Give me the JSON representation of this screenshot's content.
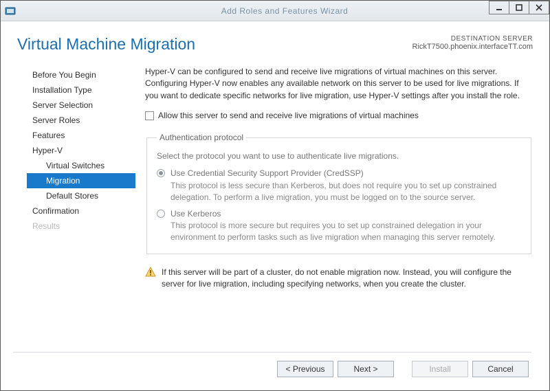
{
  "window": {
    "title": "Add Roles and Features Wizard",
    "minimize_tip": "Minimize",
    "maximize_tip": "Maximize",
    "close_tip": "Close"
  },
  "header": {
    "title": "Virtual Machine Migration",
    "dest_label": "DESTINATION SERVER",
    "dest_value": "RickT7500.phoenix.interfaceTT.com"
  },
  "nav": {
    "before": "Before You Begin",
    "install_type": "Installation Type",
    "server_selection": "Server Selection",
    "server_roles": "Server Roles",
    "features": "Features",
    "hyperv": "Hyper-V",
    "vswitches": "Virtual Switches",
    "migration": "Migration",
    "default_stores": "Default Stores",
    "confirmation": "Confirmation",
    "results": "Results"
  },
  "main": {
    "intro": "Hyper-V can be configured to send and receive live migrations of virtual machines on this server. Configuring Hyper-V now enables any available network on this server to be used for live migrations. If you want to dedicate specific networks for live migration, use Hyper-V settings after you install the role.",
    "allow_label": "Allow this server to send and receive live migrations of virtual machines",
    "group_title": "Authentication protocol",
    "group_hint": "Select the protocol you want to use to authenticate live migrations.",
    "credssp_label": "Use Credential Security Support Provider (CredSSP)",
    "credssp_desc": "This protocol is less secure than Kerberos, but does not require you to set up constrained delegation. To perform a live migration, you must be logged on to the source server.",
    "kerberos_label": "Use Kerberos",
    "kerberos_desc": "This protocol is more secure but requires you to set up constrained delegation in your environment to perform tasks such as live migration when managing this server remotely.",
    "warning": "If this server will be part of a cluster, do not enable migration now. Instead, you will configure the server for live migration, including specifying networks, when you create the cluster."
  },
  "buttons": {
    "previous": "< Previous",
    "next": "Next >",
    "install": "Install",
    "cancel": "Cancel"
  }
}
